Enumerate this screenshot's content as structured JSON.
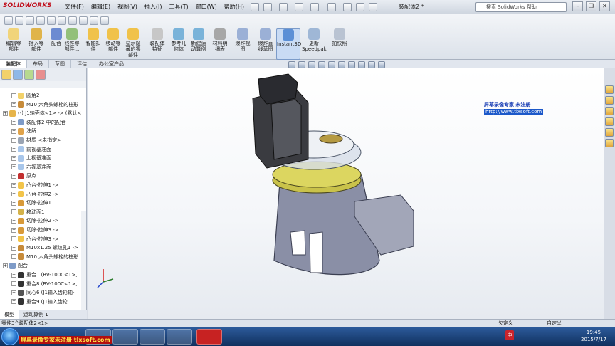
{
  "app": {
    "logo_text": "SOLIDWORKS",
    "doc_title": "装配体2 *",
    "help_search_placeholder": "搜索 SolidWorks 帮助"
  },
  "menu": [
    "文件(F)",
    "编辑(E)",
    "视图(V)",
    "插入(I)",
    "工具(T)",
    "窗口(W)",
    "帮助(H)"
  ],
  "toolbar": [
    {
      "label": "编辑零\n部件",
      "icon": "edit-component-icon"
    },
    {
      "label": "插入零\n部件",
      "icon": "insert-component-icon"
    },
    {
      "label": "配合",
      "icon": "mate-icon"
    },
    {
      "label": "线性零\n部件...",
      "icon": "linear-pattern-icon"
    },
    {
      "label": "智能扣\n件",
      "icon": "smart-fastener-icon"
    },
    {
      "label": "移动零\n部件",
      "icon": "move-component-icon"
    },
    {
      "label": "显示隐\n藏的零\n部件",
      "icon": "show-hidden-icon"
    },
    {
      "label": "装配体\n特征",
      "icon": "assembly-feature-icon"
    },
    {
      "label": "参考几\n何体",
      "icon": "reference-geometry-icon"
    },
    {
      "label": "新建运\n动算例",
      "icon": "new-motion-study-icon"
    },
    {
      "label": "材料明\n细表",
      "icon": "bom-icon"
    },
    {
      "label": "爆炸视\n图",
      "icon": "exploded-view-icon"
    },
    {
      "label": "爆炸直\n线草图",
      "icon": "explode-line-sketch-icon"
    },
    {
      "label": "Instant3D",
      "icon": "instant3d-icon"
    },
    {
      "label": "更新\nSpeedpak",
      "icon": "speedpak-icon"
    },
    {
      "label": "拍快照",
      "icon": "snapshot-icon"
    }
  ],
  "tabs": [
    "装配体",
    "布局",
    "草图",
    "评估",
    "办公室产品"
  ],
  "active_tab": "装配体",
  "tree": [
    {
      "text": "圆角2",
      "indent": 1,
      "icon": "fillet-icon"
    },
    {
      "text": "M10 六角头螺栓的柱形",
      "indent": 1,
      "icon": "hole-icon"
    },
    {
      "text": "(-) J1轴壳体<1> -> (默认<",
      "indent": 0,
      "icon": "part-icon"
    },
    {
      "text": "装配体2 中的配合",
      "indent": 1,
      "icon": "mates-folder-icon"
    },
    {
      "text": "注解",
      "indent": 1,
      "icon": "annotation-icon"
    },
    {
      "text": "材质 <未指定>",
      "indent": 1,
      "icon": "material-icon"
    },
    {
      "text": "前视基准面",
      "indent": 1,
      "icon": "plane-icon"
    },
    {
      "text": "上视基准面",
      "indent": 1,
      "icon": "plane-icon"
    },
    {
      "text": "右视基准面",
      "indent": 1,
      "icon": "plane-icon"
    },
    {
      "text": "原点",
      "indent": 1,
      "icon": "origin-icon"
    },
    {
      "text": "凸台-拉伸1 ->",
      "indent": 1,
      "icon": "boss-extrude-icon"
    },
    {
      "text": "凸台-拉伸2 ->",
      "indent": 1,
      "icon": "boss-extrude-icon"
    },
    {
      "text": "切除-拉伸1",
      "indent": 1,
      "icon": "cut-extrude-icon"
    },
    {
      "text": "移动面1",
      "indent": 1,
      "icon": "move-face-icon"
    },
    {
      "text": "切除-拉伸2 ->",
      "indent": 1,
      "icon": "cut-extrude-icon"
    },
    {
      "text": "切除-拉伸3 ->",
      "indent": 1,
      "icon": "cut-extrude-icon"
    },
    {
      "text": "凸台-拉伸3 ->",
      "indent": 1,
      "icon": "boss-extrude-icon"
    },
    {
      "text": "M10x1.25 螺纹孔1 ->",
      "indent": 1,
      "icon": "hole-icon"
    },
    {
      "text": "M10 六角头螺栓的柱形",
      "indent": 1,
      "icon": "hole-icon"
    },
    {
      "text": "配合",
      "indent": 0,
      "icon": "mates-folder-icon"
    },
    {
      "text": "重合1 (RV-100C<1>,",
      "indent": 1,
      "icon": "coincident-icon"
    },
    {
      "text": "重合8 (RV-100C<1>,",
      "indent": 1,
      "icon": "coincident-icon"
    },
    {
      "text": "同心6 (J1输入齿轮轴-",
      "indent": 1,
      "icon": "concentric-icon"
    },
    {
      "text": "重合9 (J1输入齿轮",
      "indent": 1,
      "icon": "coincident-icon"
    }
  ],
  "bottom_tabs": [
    "模型",
    "运动算例 1"
  ],
  "status": {
    "left": "零件3^装配体2<1>",
    "undefined": "欠定义",
    "custom": "自定义"
  },
  "watermark": {
    "line1": "屏幕录像专家      未注册",
    "line2": "http://www.tlxsoft.com"
  },
  "taskbar_watermark": "屏幕录像专家未注册 tlxsoft.com",
  "clock": {
    "time": "19:45",
    "date": "2015/7/17"
  },
  "lang": "中"
}
